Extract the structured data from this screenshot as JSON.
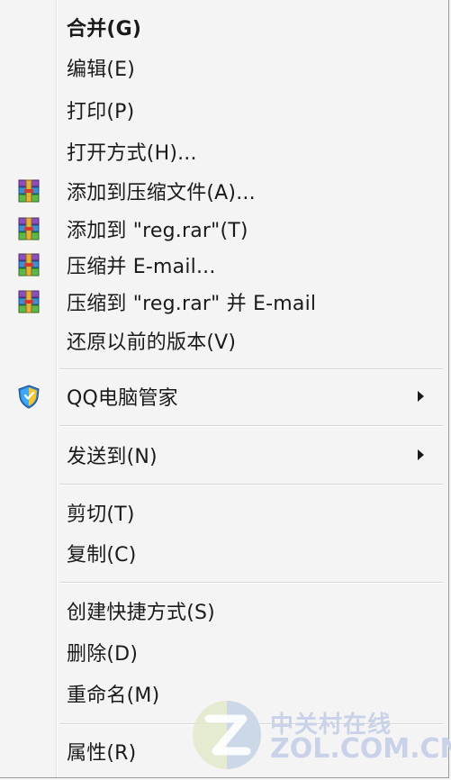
{
  "menu": {
    "items": [
      {
        "label": "合并(G)",
        "bold": true
      },
      {
        "label": "编辑(E)"
      },
      {
        "label": "打印(P)"
      },
      {
        "label": "打开方式(H)..."
      },
      {
        "label": "添加到压缩文件(A)...",
        "icon": "winrar-icon"
      },
      {
        "label": "添加到 \"reg.rar\"(T)",
        "icon": "winrar-icon"
      },
      {
        "label": "压缩并 E-mail...",
        "icon": "winrar-icon"
      },
      {
        "label": "压缩到 \"reg.rar\" 并 E-mail",
        "icon": "winrar-icon"
      },
      {
        "label": "还原以前的版本(V)"
      },
      {
        "label": "QQ电脑管家",
        "icon": "qq-guard-shield-icon",
        "submenu": true
      },
      {
        "label": "发送到(N)",
        "submenu": true
      },
      {
        "label": "剪切(T)"
      },
      {
        "label": "复制(C)"
      },
      {
        "label": "创建快捷方式(S)"
      },
      {
        "label": "删除(D)"
      },
      {
        "label": "重命名(M)"
      },
      {
        "label": "属性(R)"
      }
    ]
  },
  "watermark": {
    "cn": "中关村在线",
    "en": "ZOL.COM.CN",
    "colors": {
      "logo_left": "#bcd37a",
      "logo_right": "#93a8d6",
      "text": "#c9d2e8"
    }
  },
  "colors": {
    "menu_bg": "#f4f4f4",
    "separator": "#d7d7d7",
    "text": "#1a1a1a"
  }
}
